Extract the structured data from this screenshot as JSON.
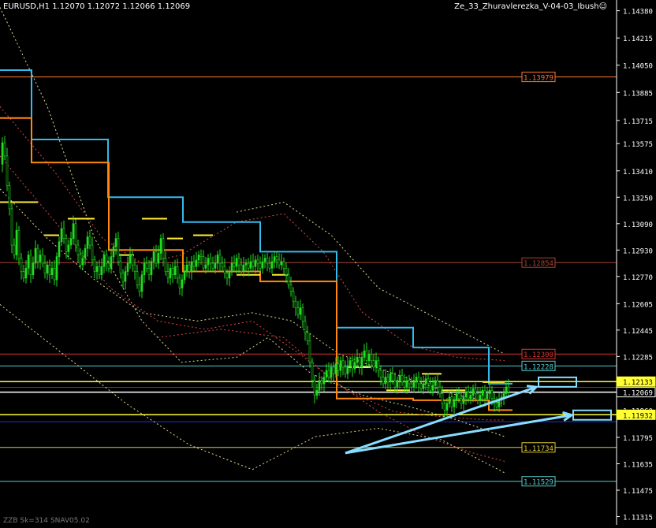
{
  "header": {
    "symbol_text": "EURUSD,H1  1.12070 1.12072 1.12066 1.12069",
    "indicator_text": "Ze_33_Zhuravlerezka_V-04-03_Ibush☺"
  },
  "footer": {
    "text": "ZZB Sk=314 SNAV05.02"
  },
  "colors": {
    "background": "#000000",
    "axis": "#ffffff",
    "candle": "#22dd22",
    "stair_blue": "#33bbee",
    "stair_orange": "#ff8811",
    "price_box_bg": "#000000"
  },
  "chart_data": {
    "type": "candlestick",
    "symbol": "EURUSD",
    "timeframe": "H1",
    "ylim": [
      1.11265,
      1.14445
    ],
    "y_ticks": [
      "1.14380",
      "1.14215",
      "1.14050",
      "1.13885",
      "1.13715",
      "1.13575",
      "1.13410",
      "1.13250",
      "1.13090",
      "1.12930",
      "1.12770",
      "1.12605",
      "1.12445",
      "1.12285",
      "1.12125",
      "1.11960",
      "1.11795",
      "1.11635",
      "1.11475",
      "1.11315"
    ],
    "horizontal_levels": [
      {
        "price": 1.13979,
        "label": "1.13979",
        "color": "#ff7733",
        "box": true
      },
      {
        "price": 1.12854,
        "label": "1.12854",
        "color": "#aa4433",
        "box": true
      },
      {
        "price": 1.123,
        "label": "1.12300",
        "color": "#dd3333",
        "box": true
      },
      {
        "price": 1.12228,
        "label": "1.12228",
        "color": "#55cccc",
        "box": true
      },
      {
        "price": 1.12133,
        "label": "1.12133",
        "color": "#ffff33",
        "box": true,
        "fill": true
      },
      {
        "price": 1.12069,
        "label": "1.12069",
        "color": "#ffffff",
        "box": true,
        "fill": true,
        "current": true
      },
      {
        "price": 1.11932,
        "label": "1.11932",
        "color": "#ffff33",
        "box": true,
        "fill": true
      },
      {
        "price": 1.11734,
        "label": "1.11734",
        "color": "#ddcc33",
        "box": true
      },
      {
        "price": 1.11529,
        "label": "1.11529",
        "color": "#55cccc",
        "box": true
      },
      {
        "price": 1.12098,
        "label": "",
        "color": "#aa2222",
        "box": false
      },
      {
        "price": 1.1189,
        "label": "",
        "color": "#2233dd",
        "box": false
      }
    ],
    "close_path": [
      [
        0,
        1.1345
      ],
      [
        3,
        1.1358
      ],
      [
        6,
        1.135
      ],
      [
        9,
        1.1332
      ],
      [
        12,
        1.1318
      ],
      [
        15,
        1.1296
      ],
      [
        18,
        1.129
      ],
      [
        21,
        1.1305
      ],
      [
        24,
        1.1288
      ],
      [
        27,
        1.128
      ],
      [
        30,
        1.1276
      ],
      [
        33,
        1.1282
      ],
      [
        36,
        1.129
      ],
      [
        39,
        1.1278
      ],
      [
        42,
        1.1285
      ],
      [
        45,
        1.1294
      ],
      [
        48,
        1.1286
      ],
      [
        51,
        1.129
      ],
      [
        54,
        1.1285
      ],
      [
        57,
        1.1279
      ],
      [
        60,
        1.1284
      ],
      [
        63,
        1.1278
      ],
      [
        66,
        1.1282
      ],
      [
        69,
        1.1275
      ],
      [
        72,
        1.1289
      ],
      [
        75,
        1.1298
      ],
      [
        78,
        1.1306
      ],
      [
        81,
        1.13
      ],
      [
        84,
        1.1292
      ],
      [
        87,
        1.1296
      ],
      [
        90,
        1.13
      ],
      [
        93,
        1.1309
      ],
      [
        96,
        1.1296
      ],
      [
        99,
        1.129
      ],
      [
        102,
        1.1284
      ],
      [
        105,
        1.1288
      ],
      [
        108,
        1.1294
      ],
      [
        111,
        1.1301
      ],
      [
        114,
        1.1296
      ],
      [
        117,
        1.1287
      ],
      [
        120,
        1.128
      ],
      [
        123,
        1.1283
      ],
      [
        126,
        1.1278
      ],
      [
        129,
        1.1283
      ],
      [
        132,
        1.129
      ],
      [
        135,
        1.1285
      ],
      [
        138,
        1.1282
      ],
      [
        141,
        1.1289
      ],
      [
        144,
        1.1295
      ],
      [
        147,
        1.13
      ],
      [
        150,
        1.1286
      ],
      [
        153,
        1.1279
      ],
      [
        156,
        1.1274
      ],
      [
        159,
        1.128
      ],
      [
        162,
        1.1285
      ],
      [
        165,
        1.129
      ],
      [
        168,
        1.1284
      ],
      [
        171,
        1.128
      ],
      [
        174,
        1.1272
      ],
      [
        177,
        1.1268
      ],
      [
        180,
        1.1278
      ],
      [
        183,
        1.1285
      ],
      [
        186,
        1.1282
      ],
      [
        189,
        1.1278
      ],
      [
        192,
        1.1286
      ],
      [
        195,
        1.1292
      ],
      [
        198,
        1.1285
      ],
      [
        201,
        1.1291
      ],
      [
        204,
        1.13
      ],
      [
        207,
        1.1288
      ],
      [
        210,
        1.128
      ],
      [
        213,
        1.1276
      ],
      [
        216,
        1.1282
      ],
      [
        219,
        1.1278
      ],
      [
        222,
        1.1283
      ],
      [
        225,
        1.1276
      ],
      [
        228,
        1.127
      ],
      [
        231,
        1.1275
      ],
      [
        234,
        1.128
      ],
      [
        237,
        1.1284
      ],
      [
        240,
        1.128
      ],
      [
        243,
        1.1286
      ],
      [
        246,
        1.1283
      ],
      [
        249,
        1.1287
      ],
      [
        252,
        1.129
      ],
      [
        255,
        1.1289
      ],
      [
        258,
        1.1282
      ],
      [
        261,
        1.1284
      ],
      [
        264,
        1.1288
      ],
      [
        267,
        1.1285
      ],
      [
        270,
        1.1282
      ],
      [
        273,
        1.1285
      ],
      [
        276,
        1.129
      ],
      [
        279,
        1.1285
      ],
      [
        282,
        1.1283
      ],
      [
        285,
        1.1279
      ],
      [
        288,
        1.1276
      ],
      [
        291,
        1.128
      ],
      [
        294,
        1.1285
      ],
      [
        297,
        1.1283
      ],
      [
        300,
        1.1288
      ],
      [
        303,
        1.1284
      ],
      [
        306,
        1.128
      ],
      [
        309,
        1.1284
      ],
      [
        312,
        1.1285
      ],
      [
        315,
        1.1282
      ],
      [
        318,
        1.1286
      ],
      [
        321,
        1.1283
      ],
      [
        324,
        1.1287
      ],
      [
        327,
        1.1285
      ],
      [
        330,
        1.1282
      ],
      [
        333,
        1.1286
      ],
      [
        336,
        1.1288
      ],
      [
        339,
        1.1285
      ],
      [
        342,
        1.1282
      ],
      [
        345,
        1.1286
      ],
      [
        348,
        1.1289
      ],
      [
        351,
        1.1287
      ],
      [
        354,
        1.1284
      ],
      [
        357,
        1.1286
      ],
      [
        360,
        1.1282
      ],
      [
        363,
        1.1278
      ],
      [
        366,
        1.1272
      ],
      [
        369,
        1.1268
      ],
      [
        372,
        1.1262
      ],
      [
        375,
        1.1258
      ],
      [
        378,
        1.1254
      ],
      [
        381,
        1.1258
      ],
      [
        384,
        1.125
      ],
      [
        387,
        1.1243
      ],
      [
        390,
        1.1238
      ],
      [
        393,
        1.1225
      ],
      [
        396,
        1.1214
      ],
      [
        399,
        1.1205
      ],
      [
        402,
        1.1208
      ],
      [
        405,
        1.1214
      ],
      [
        408,
        1.1212
      ],
      [
        411,
        1.1216
      ],
      [
        414,
        1.122
      ],
      [
        417,
        1.1216
      ],
      [
        420,
        1.1222
      ],
      [
        423,
        1.1218
      ],
      [
        426,
        1.1224
      ],
      [
        429,
        1.122
      ],
      [
        432,
        1.1226
      ],
      [
        435,
        1.1222
      ],
      [
        438,
        1.1218
      ],
      [
        441,
        1.1223
      ],
      [
        444,
        1.1226
      ],
      [
        447,
        1.1221
      ],
      [
        450,
        1.1225
      ],
      [
        453,
        1.1228
      ],
      [
        456,
        1.1222
      ],
      [
        459,
        1.1228
      ],
      [
        462,
        1.1232
      ],
      [
        465,
        1.1226
      ],
      [
        468,
        1.123
      ],
      [
        471,
        1.1226
      ],
      [
        474,
        1.1222
      ],
      [
        477,
        1.1226
      ],
      [
        480,
        1.122
      ],
      [
        483,
        1.1216
      ],
      [
        486,
        1.1212
      ],
      [
        489,
        1.1216
      ],
      [
        492,
        1.1213
      ],
      [
        495,
        1.1218
      ],
      [
        498,
        1.1214
      ],
      [
        501,
        1.121
      ],
      [
        504,
        1.1214
      ],
      [
        507,
        1.1217
      ],
      [
        510,
        1.1213
      ],
      [
        513,
        1.121
      ],
      [
        516,
        1.1214
      ],
      [
        519,
        1.1212
      ],
      [
        522,
        1.121
      ],
      [
        525,
        1.1213
      ],
      [
        528,
        1.1216
      ],
      [
        531,
        1.1212
      ],
      [
        534,
        1.1209
      ],
      [
        537,
        1.1212
      ],
      [
        540,
        1.1215
      ],
      [
        543,
        1.1212
      ],
      [
        546,
        1.1208
      ],
      [
        549,
        1.1211
      ],
      [
        552,
        1.1214
      ],
      [
        555,
        1.121
      ],
      [
        558,
        1.1206
      ],
      [
        561,
        1.12
      ],
      [
        564,
        1.1196
      ],
      [
        567,
        1.12
      ],
      [
        570,
        1.1204
      ],
      [
        573,
        1.1198
      ],
      [
        576,
        1.1202
      ],
      [
        579,
        1.1206
      ],
      [
        582,
        1.1203
      ],
      [
        585,
        1.12
      ],
      [
        588,
        1.1204
      ],
      [
        591,
        1.1207
      ],
      [
        594,
        1.1203
      ],
      [
        597,
        1.1205
      ],
      [
        600,
        1.1209
      ],
      [
        603,
        1.1206
      ],
      [
        606,
        1.1202
      ],
      [
        609,
        1.1205
      ],
      [
        612,
        1.1208
      ],
      [
        615,
        1.1203
      ],
      [
        618,
        1.1206
      ],
      [
        621,
        1.1208
      ],
      [
        624,
        1.1203
      ],
      [
        627,
        1.12
      ],
      [
        630,
        1.1198
      ],
      [
        633,
        1.1202
      ],
      [
        636,
        1.1204
      ],
      [
        639,
        1.1206
      ],
      [
        642,
        1.121
      ],
      [
        645,
        1.1207
      ]
    ],
    "stair_blue": [
      [
        0,
        1.1402
      ],
      [
        40,
        1.1402
      ],
      [
        40,
        1.136
      ],
      [
        137,
        1.136
      ],
      [
        137,
        1.1325
      ],
      [
        232,
        1.1325
      ],
      [
        232,
        1.131
      ],
      [
        330,
        1.131
      ],
      [
        330,
        1.1292
      ],
      [
        427,
        1.1292
      ],
      [
        427,
        1.1246
      ],
      [
        524,
        1.1246
      ],
      [
        524,
        1.1234
      ],
      [
        620,
        1.1234
      ],
      [
        620,
        1.1212
      ],
      [
        650,
        1.1212
      ]
    ],
    "stair_orange": [
      [
        0,
        1.1373
      ],
      [
        40,
        1.1373
      ],
      [
        40,
        1.1346
      ],
      [
        138,
        1.1346
      ],
      [
        138,
        1.1293
      ],
      [
        232,
        1.1293
      ],
      [
        232,
        1.128
      ],
      [
        330,
        1.128
      ],
      [
        330,
        1.1274
      ],
      [
        427,
        1.1274
      ],
      [
        427,
        1.1203
      ],
      [
        524,
        1.1203
      ],
      [
        524,
        1.1202
      ],
      [
        620,
        1.1202
      ],
      [
        620,
        1.1196
      ],
      [
        650,
        1.1196
      ]
    ],
    "yellow_segments": [
      [
        0,
        1.1322,
        48
      ],
      [
        56,
        1.1302,
        75
      ],
      [
        86,
        1.1312,
        120
      ],
      [
        150,
        1.129,
        170
      ],
      [
        180,
        1.1312,
        212
      ],
      [
        212,
        1.13,
        232
      ],
      [
        245,
        1.1302,
        270
      ],
      [
        300,
        1.1278,
        330
      ],
      [
        345,
        1.1278,
        365
      ],
      [
        440,
        1.1222,
        470
      ],
      [
        490,
        1.1208,
        520
      ],
      [
        535,
        1.1218,
        560
      ],
      [
        560,
        1.1208,
        590
      ],
      [
        612,
        1.1213,
        640
      ]
    ],
    "dotted_curves": [
      {
        "color": "#ffffaa",
        "points": [
          [
            0,
            1.144
          ],
          [
            60,
            1.138
          ],
          [
            120,
            1.13
          ],
          [
            180,
            1.125
          ],
          [
            230,
            1.1225
          ],
          [
            300,
            1.1228
          ],
          [
            340,
            1.124
          ],
          [
            395,
            1.1218
          ],
          [
            460,
            1.1205
          ],
          [
            520,
            1.1198
          ],
          [
            580,
            1.119
          ],
          [
            640,
            1.118
          ]
        ]
      },
      {
        "color": "#ffffaa",
        "points": [
          [
            0,
            1.133
          ],
          [
            60,
            1.13
          ],
          [
            120,
            1.1275
          ],
          [
            180,
            1.1255
          ],
          [
            250,
            1.125
          ],
          [
            320,
            1.1255
          ],
          [
            370,
            1.125
          ],
          [
            430,
            1.123
          ],
          [
            500,
            1.1218
          ],
          [
            580,
            1.1205
          ],
          [
            640,
            1.12
          ]
        ]
      },
      {
        "color": "#ffffaa",
        "points": [
          [
            0,
            1.126
          ],
          [
            80,
            1.123
          ],
          [
            160,
            1.12
          ],
          [
            240,
            1.1175
          ],
          [
            320,
            1.116
          ],
          [
            400,
            1.118
          ],
          [
            480,
            1.1185
          ],
          [
            560,
            1.1178
          ],
          [
            640,
            1.1158
          ]
        ]
      },
      {
        "color": "#ffffaa",
        "points": [
          [
            300,
            1.1316
          ],
          [
            360,
            1.1322
          ],
          [
            420,
            1.1302
          ],
          [
            480,
            1.127
          ],
          [
            540,
            1.1255
          ],
          [
            600,
            1.124
          ],
          [
            640,
            1.123
          ]
        ]
      },
      {
        "color": "#ff5555",
        "points": [
          [
            0,
            1.138
          ],
          [
            70,
            1.134
          ],
          [
            130,
            1.13
          ],
          [
            180,
            1.1285
          ],
          [
            230,
            1.129
          ],
          [
            300,
            1.131
          ],
          [
            360,
            1.1315
          ],
          [
            410,
            1.1292
          ],
          [
            460,
            1.1255
          ],
          [
            520,
            1.1235
          ],
          [
            580,
            1.1228
          ],
          [
            640,
            1.1226
          ]
        ]
      },
      {
        "color": "#ff5555",
        "points": [
          [
            0,
            1.135
          ],
          [
            70,
            1.131
          ],
          [
            140,
            1.127
          ],
          [
            200,
            1.125
          ],
          [
            260,
            1.1245
          ],
          [
            320,
            1.125
          ],
          [
            380,
            1.123
          ],
          [
            440,
            1.1208
          ],
          [
            500,
            1.1195
          ],
          [
            560,
            1.1192
          ],
          [
            620,
            1.119
          ],
          [
            640,
            1.119
          ]
        ]
      },
      {
        "color": "#ff5555",
        "points": [
          [
            200,
            1.124
          ],
          [
            280,
            1.1245
          ],
          [
            360,
            1.124
          ],
          [
            420,
            1.1215
          ],
          [
            480,
            1.1195
          ],
          [
            540,
            1.118
          ],
          [
            600,
            1.117
          ],
          [
            640,
            1.1165
          ]
        ]
      }
    ],
    "arrows": [
      {
        "from": [
          438,
          1.117
        ],
        "to": [
          680,
          1.121
        ],
        "color": "#88ddff",
        "box_price": 1.1213,
        "box_x": 683
      },
      {
        "from": [
          438,
          1.117
        ],
        "to": [
          725,
          1.1193
        ],
        "color": "#88ddff",
        "box_price": 1.1193,
        "box_x": 727
      }
    ]
  }
}
